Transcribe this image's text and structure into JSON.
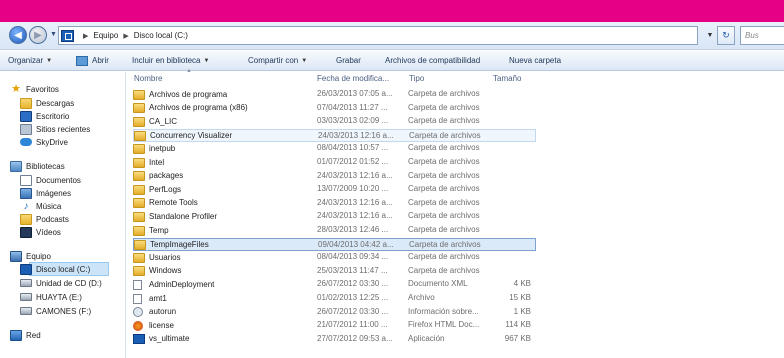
{
  "address": {
    "crumbs": [
      "Equipo",
      "Disco local (C:)"
    ],
    "search_placeholder": "Bus"
  },
  "toolbar": {
    "organize": "Organizar",
    "open": "Abrir",
    "include_library": "Incluir en biblioteca",
    "share": "Compartir con",
    "burn": "Grabar",
    "compat": "Archivos de compatibilidad",
    "new_folder": "Nueva carpeta"
  },
  "nav": {
    "favorites": "Favoritos",
    "downloads": "Descargas",
    "desktop": "Escritorio",
    "recent": "Sitios recientes",
    "skydrive": "SkyDrive",
    "libraries": "Bibliotecas",
    "documents": "Documentos",
    "images": "Imágenes",
    "music": "Música",
    "podcasts": "Podcasts",
    "videos": "Vídeos",
    "computer": "Equipo",
    "local_disk": "Disco local (C:)",
    "cd_drive": "Unidad de CD (D:)",
    "huayta": "HUAYTA (E:)",
    "camones": "CAMONES (F:)",
    "network": "Red"
  },
  "columns": {
    "name": "Nombre",
    "date": "Fecha de modifica...",
    "type": "Tipo",
    "size": "Tamaño"
  },
  "files": [
    {
      "name": "Archivos de programa",
      "date": "26/03/2013 07:05 a...",
      "type": "Carpeta de archivos",
      "size": ""
    },
    {
      "name": "Archivos de programa (x86)",
      "date": "07/04/2013 11:27 ...",
      "type": "Carpeta de archivos",
      "size": ""
    },
    {
      "name": "CA_LIC",
      "date": "03/03/2013 02:09 ...",
      "type": "Carpeta de archivos",
      "size": ""
    },
    {
      "name": "Concurrency Visualizer",
      "date": "24/03/2013 12:16 a...",
      "type": "Carpeta de archivos",
      "size": ""
    },
    {
      "name": "inetpub",
      "date": "08/04/2013 10:57 ...",
      "type": "Carpeta de archivos",
      "size": ""
    },
    {
      "name": "Intel",
      "date": "01/07/2012 01:52 ...",
      "type": "Carpeta de archivos",
      "size": ""
    },
    {
      "name": "packages",
      "date": "24/03/2013 12:16 a...",
      "type": "Carpeta de archivos",
      "size": ""
    },
    {
      "name": "PerfLogs",
      "date": "13/07/2009 10:20 ...",
      "type": "Carpeta de archivos",
      "size": ""
    },
    {
      "name": "Remote Tools",
      "date": "24/03/2013 12:16 a...",
      "type": "Carpeta de archivos",
      "size": ""
    },
    {
      "name": "Standalone Profiler",
      "date": "24/03/2013 12:16 a...",
      "type": "Carpeta de archivos",
      "size": ""
    },
    {
      "name": "Temp",
      "date": "28/03/2013 12:46 ...",
      "type": "Carpeta de archivos",
      "size": ""
    },
    {
      "name": "TempImageFiles",
      "date": "09/04/2013 04:42 a...",
      "type": "Carpeta de archivos",
      "size": ""
    },
    {
      "name": "Usuarios",
      "date": "08/04/2013 09:34 ...",
      "type": "Carpeta de archivos",
      "size": ""
    },
    {
      "name": "Windows",
      "date": "25/03/2013 11:47 ...",
      "type": "Carpeta de archivos",
      "size": ""
    },
    {
      "name": "AdminDeployment",
      "date": "26/07/2012 03:30 ...",
      "type": "Documento XML",
      "size": "4 KB"
    },
    {
      "name": "amt1",
      "date": "01/02/2013 12:25 ...",
      "type": "Archivo",
      "size": "15 KB"
    },
    {
      "name": "autorun",
      "date": "26/07/2012 03:30 ...",
      "type": "Información sobre...",
      "size": "1 KB"
    },
    {
      "name": "license",
      "date": "21/07/2012 11:00 ...",
      "type": "Firefox HTML Doc...",
      "size": "114 KB"
    },
    {
      "name": "vs_ultimate",
      "date": "27/07/2012 09:53 a...",
      "type": "Aplicación",
      "size": "967 KB"
    }
  ],
  "colors": {
    "title_bar": "#e60085",
    "selection": "#dbeaf9",
    "selection_border": "#7da2ce"
  }
}
